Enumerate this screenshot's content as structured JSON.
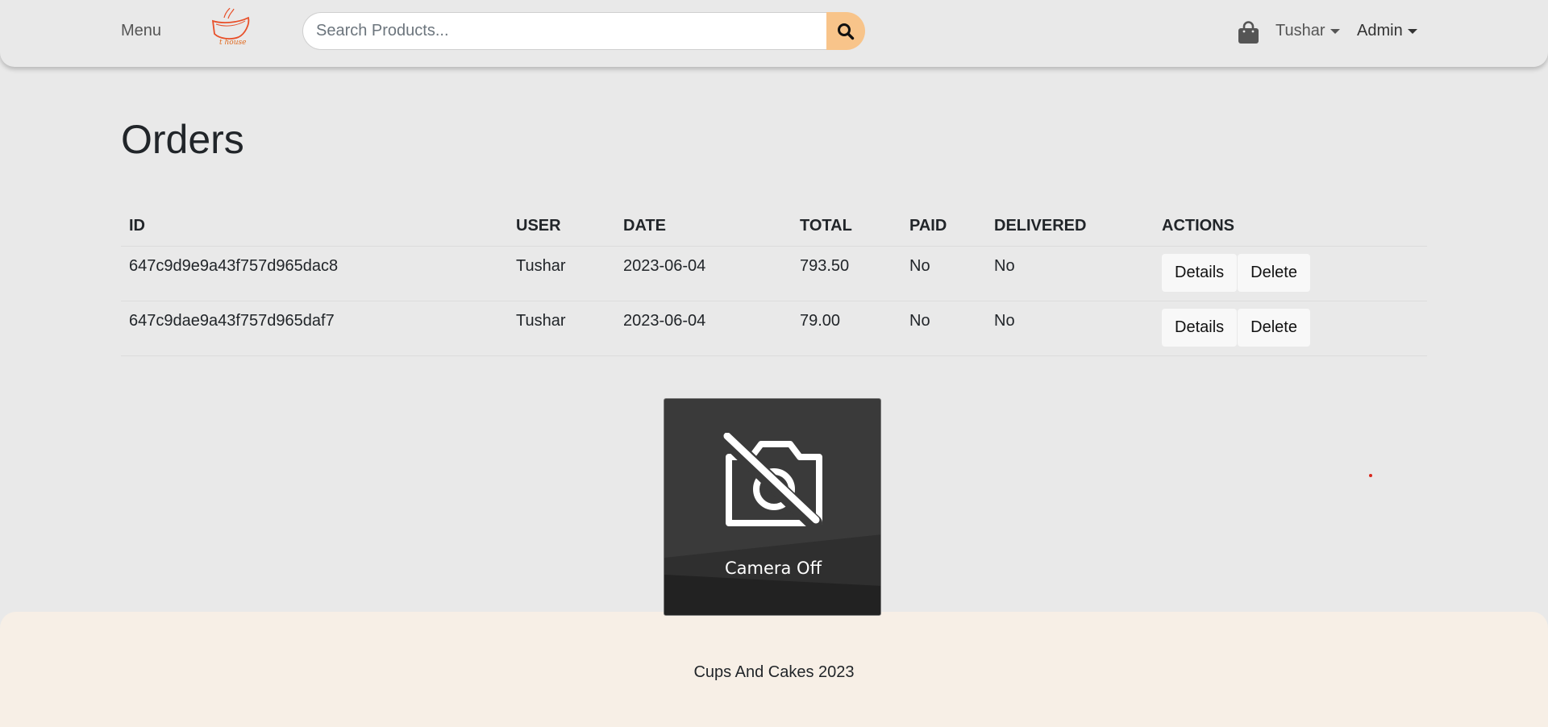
{
  "navbar": {
    "menu_label": "Menu",
    "logo_text": "t house",
    "search": {
      "placeholder": "Search Products...",
      "value": ""
    },
    "user_dropdown": "Tushar",
    "admin_dropdown": "Admin"
  },
  "page": {
    "title": "Orders"
  },
  "orders_table": {
    "headers": [
      "ID",
      "USER",
      "DATE",
      "TOTAL",
      "PAID",
      "DELIVERED",
      "ACTIONS"
    ],
    "rows": [
      {
        "id": "647c9d9e9a43f757d965dac8",
        "user": "Tushar",
        "date": "2023-06-04",
        "total": "793.50",
        "paid": "No",
        "delivered": "No",
        "details_label": "Details",
        "delete_label": "Delete"
      },
      {
        "id": "647c9dae9a43f757d965daf7",
        "user": "Tushar",
        "date": "2023-06-04",
        "total": "79.00",
        "paid": "No",
        "delivered": "No",
        "details_label": "Details",
        "delete_label": "Delete"
      }
    ]
  },
  "camera_overlay": {
    "label": "Camera Off"
  },
  "footer": {
    "text": "Cups And Cakes 2023"
  },
  "colors": {
    "background": "#e9e9e9",
    "search_button": "#f8c48a",
    "footer_bg": "#f7efe6",
    "logo_accent": "#e8502a"
  },
  "icons": {
    "search": "search-icon",
    "cart": "shopping-bag-icon",
    "camera": "camera-off-icon"
  }
}
